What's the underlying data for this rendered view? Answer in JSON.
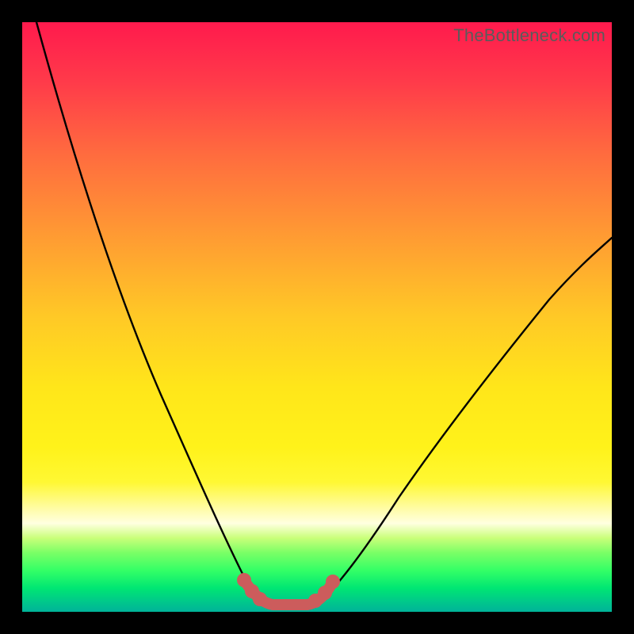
{
  "watermark": "TheBottleneck.com",
  "chart_data": {
    "type": "line",
    "title": "",
    "xlabel": "",
    "ylabel": "",
    "xlim": [
      0,
      100
    ],
    "ylim": [
      0,
      100
    ],
    "series": [
      {
        "name": "left-curve",
        "x": [
          2,
          6,
          10,
          15,
          20,
          25,
          30,
          33,
          36,
          38,
          40
        ],
        "values": [
          100,
          82,
          66,
          50,
          36,
          24,
          14,
          8,
          4,
          2,
          1
        ]
      },
      {
        "name": "right-curve",
        "x": [
          48,
          52,
          58,
          65,
          73,
          82,
          92,
          100
        ],
        "values": [
          1,
          3,
          8,
          16,
          27,
          40,
          54,
          64
        ]
      },
      {
        "name": "optimal-range-flat",
        "x": [
          37,
          40,
          44,
          48,
          50
        ],
        "values": [
          2,
          1,
          1,
          1,
          2
        ]
      }
    ],
    "optimal_range": {
      "start_x": 37,
      "end_x": 50
    },
    "gradient_meaning": "top=bottleneck (red), bottom=balanced (green)"
  }
}
